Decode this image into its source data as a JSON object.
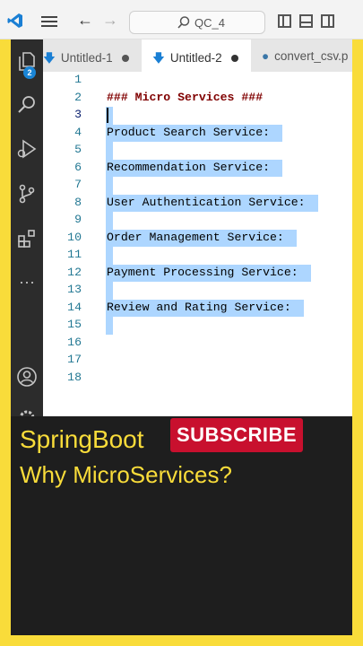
{
  "titlebar": {
    "search_text": "QC_4"
  },
  "activity_bar": {
    "explorer_badge": "2",
    "more_label": "···"
  },
  "tabs": [
    {
      "label": "Untitled-1",
      "active": false,
      "modified": true
    },
    {
      "label": "Untitled-2",
      "active": true,
      "modified": true
    },
    {
      "label": "convert_csv.p",
      "active": false,
      "modified": false
    }
  ],
  "editor": {
    "lines": [
      {
        "n": "1",
        "text": ""
      },
      {
        "n": "2",
        "text": "### Micro Services ###"
      },
      {
        "n": "3",
        "text": ""
      },
      {
        "n": "4",
        "text": "Product Search Service: "
      },
      {
        "n": "5",
        "text": ""
      },
      {
        "n": "6",
        "text": "Recommendation Service: "
      },
      {
        "n": "7",
        "text": ""
      },
      {
        "n": "8",
        "text": "User Authentication Service: "
      },
      {
        "n": "9",
        "text": ""
      },
      {
        "n": "10",
        "text": "Order Management Service: "
      },
      {
        "n": "11",
        "text": ""
      },
      {
        "n": "12",
        "text": "Payment Processing Service: "
      },
      {
        "n": "13",
        "text": ""
      },
      {
        "n": "14",
        "text": "Review and Rating Service: "
      },
      {
        "n": "15",
        "text": ""
      },
      {
        "n": "16",
        "text": ""
      },
      {
        "n": "17",
        "text": ""
      },
      {
        "n": "18",
        "text": ""
      }
    ]
  },
  "overlay": {
    "title": "SpringBoot",
    "subscribe_label": "SUBSCRIBE",
    "subtitle": "Why MicroServices?"
  },
  "colors": {
    "frame_yellow": "#f9dc3a",
    "subscribe_red": "#c8102e",
    "selection": "#add6ff",
    "heading": "#800000"
  }
}
